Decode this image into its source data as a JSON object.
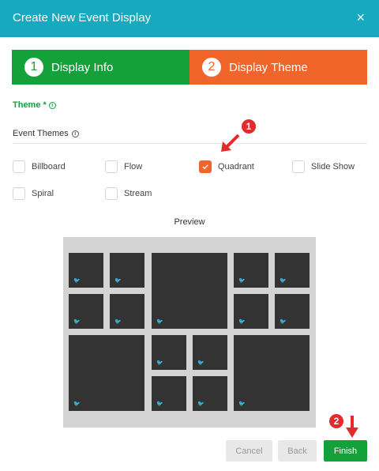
{
  "dialog": {
    "title": "Create New Event Display",
    "close_glyph": "×"
  },
  "steps": [
    {
      "number": "1",
      "label": "Display Info",
      "color": "#15a13a"
    },
    {
      "number": "2",
      "label": "Display Theme",
      "color": "#f0652a"
    }
  ],
  "theme_field": {
    "label": "Theme",
    "required_mark": "*",
    "info_glyph": "i"
  },
  "event_themes": {
    "heading": "Event Themes",
    "info_glyph": "i",
    "options": [
      {
        "label": "Billboard",
        "checked": false
      },
      {
        "label": "Flow",
        "checked": false
      },
      {
        "label": "Quadrant",
        "checked": true
      },
      {
        "label": "Slide Show",
        "checked": false
      },
      {
        "label": "Spiral",
        "checked": false
      },
      {
        "label": "Stream",
        "checked": false
      }
    ]
  },
  "annotations": {
    "a1": "1",
    "a2": "2",
    "arrow_glyph": "⬋",
    "arrow_down_glyph": "⬇",
    "color": "#e22b2b"
  },
  "preview": {
    "label": "Preview",
    "tile_icon": "twitter-bird-icon",
    "bird_glyph": "🐦"
  },
  "footer": {
    "cancel": "Cancel",
    "back": "Back",
    "finish": "Finish"
  }
}
